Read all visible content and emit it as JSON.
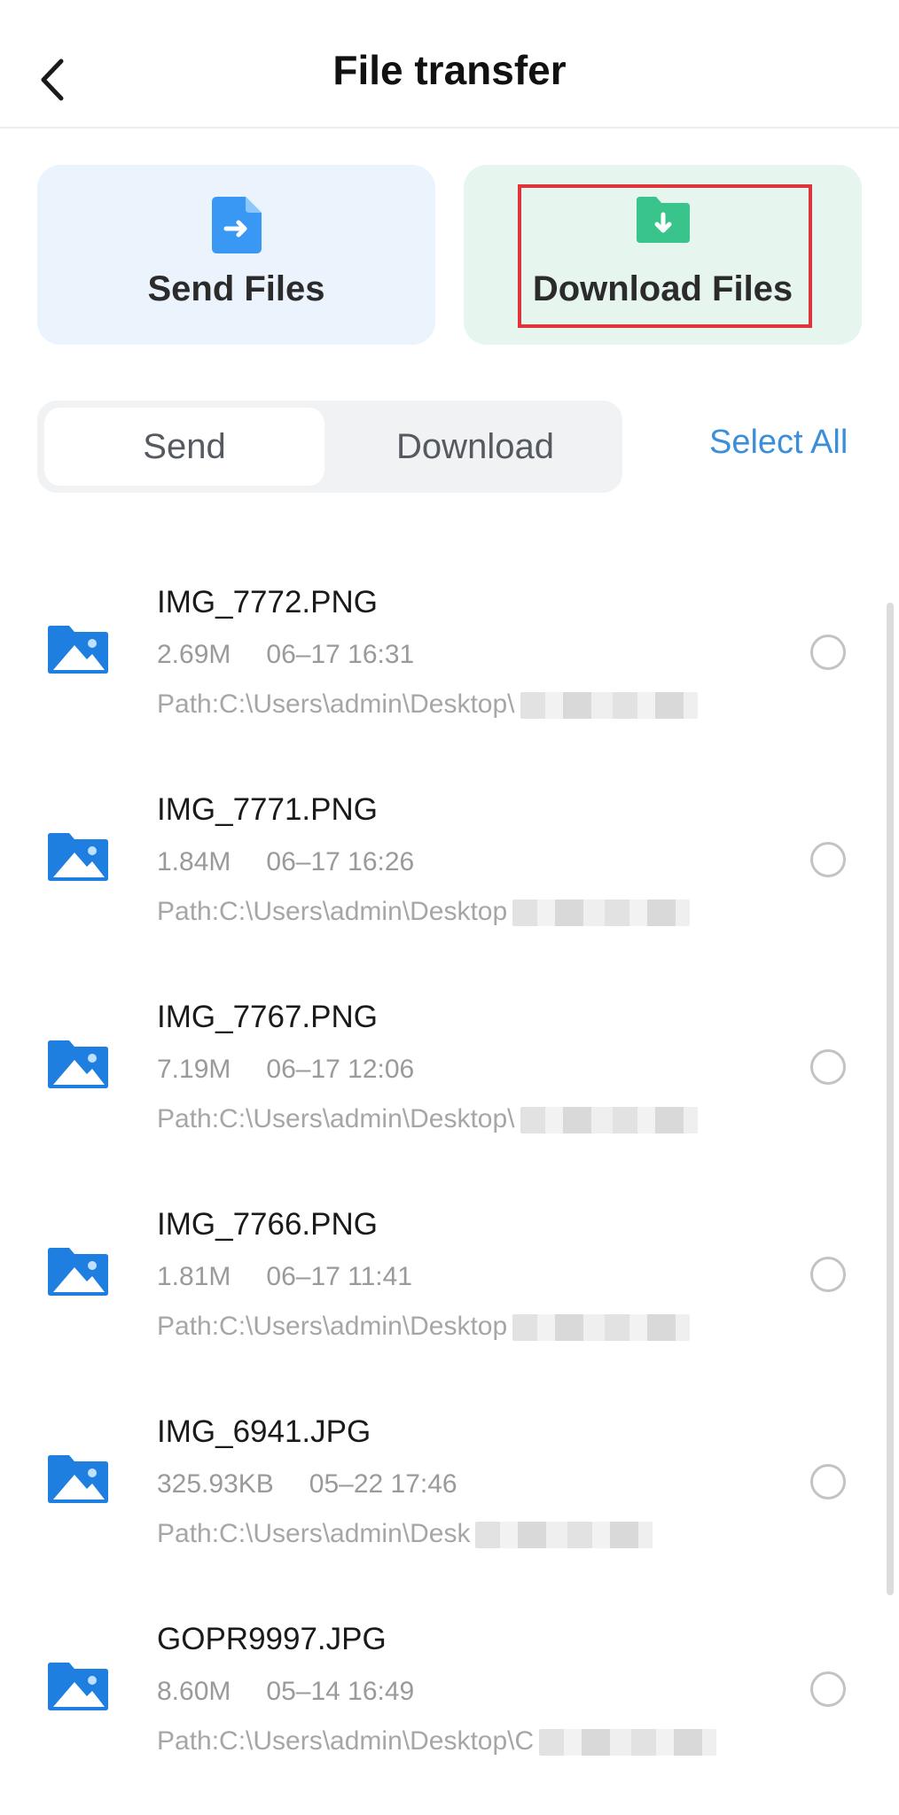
{
  "header": {
    "title": "File transfer",
    "back_icon": "chevron-left-icon"
  },
  "cards": {
    "send": {
      "label": "Send Files",
      "icon": "file-send-icon",
      "color": "#3a98f5"
    },
    "download": {
      "label": "Download Files",
      "icon": "folder-download-icon",
      "color": "#38c48a"
    }
  },
  "tabs": {
    "items": [
      {
        "label": "Send",
        "active": true
      },
      {
        "label": "Download",
        "active": false
      }
    ],
    "select_all": "Select All"
  },
  "files": [
    {
      "name": "IMG_7772.PNG",
      "size": "2.69M",
      "time": "06–17 16:31",
      "path": "Path:C:\\Users\\admin\\Desktop\\"
    },
    {
      "name": "IMG_7771.PNG",
      "size": "1.84M",
      "time": "06–17 16:26",
      "path": "Path:C:\\Users\\admin\\Desktop"
    },
    {
      "name": "IMG_7767.PNG",
      "size": "7.19M",
      "time": "06–17 12:06",
      "path": "Path:C:\\Users\\admin\\Desktop\\"
    },
    {
      "name": "IMG_7766.PNG",
      "size": "1.81M",
      "time": "06–17 11:41",
      "path": "Path:C:\\Users\\admin\\Desktop"
    },
    {
      "name": "IMG_6941.JPG",
      "size": "325.93KB",
      "time": "05–22 17:46",
      "path": "Path:C:\\Users\\admin\\Desk"
    },
    {
      "name": "GOPR9997.JPG",
      "size": "8.60M",
      "time": "05–14 16:49",
      "path": "Path:C:\\Users\\admin\\Desktop\\C"
    }
  ],
  "colors": {
    "accent_blue": "#3a8fd8",
    "highlight_red": "#e0343a",
    "file_icon_blue": "#1f7fe0"
  }
}
